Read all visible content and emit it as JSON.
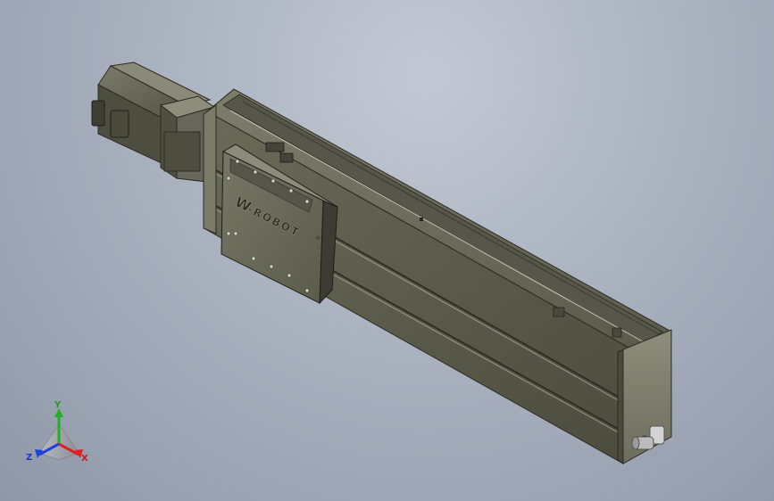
{
  "viewport": {
    "background_top": "#c3c9d4",
    "background_bottom": "#8f98a8"
  },
  "model": {
    "part": "linear-actuator-module",
    "body_color": "#5f5f4f",
    "carriage_color": "#6b6b5b",
    "logo_text": "-ROBOT",
    "logo_mark": "W",
    "logo_superscript": "®"
  },
  "triad": {
    "x_label": "X",
    "y_label": "Y",
    "z_label": "Z",
    "x_color": "#e02020",
    "y_color": "#20b020",
    "z_color": "#2040e0"
  }
}
